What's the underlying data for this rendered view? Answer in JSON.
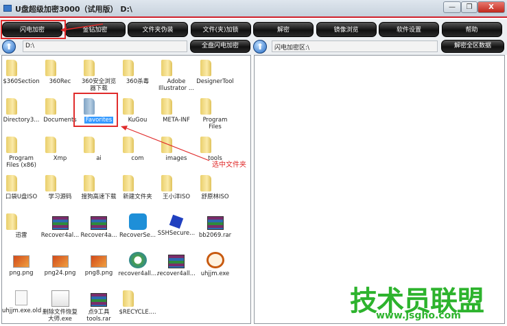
{
  "window": {
    "title": "U盘超级加密3000（试用版） D:\\",
    "minimize": "—",
    "restore": "❐",
    "close": "X"
  },
  "toolbar": {
    "buttons": [
      "闪电加密",
      "金钻加密",
      "文件夹伪装",
      "文件(夹)加锁",
      "解密",
      "镜像浏览",
      "软件设置",
      "帮助"
    ]
  },
  "left": {
    "path": "D:\\",
    "action": "全盘闪电加密"
  },
  "right": {
    "path": "闪电加密区:\\",
    "action": "解密全区数据"
  },
  "files": [
    {
      "name": "$360Section",
      "type": "folder"
    },
    {
      "name": "360Rec",
      "type": "folder"
    },
    {
      "name": "360安全浏览器下载",
      "type": "folder"
    },
    {
      "name": "360杀毒",
      "type": "folder"
    },
    {
      "name": "Adobe Illustrator ...",
      "type": "folder"
    },
    {
      "name": "DesignerTool",
      "type": "folder"
    },
    {
      "name": "Directory3...",
      "type": "folder"
    },
    {
      "name": "Documents",
      "type": "folder"
    },
    {
      "name": "Favorites",
      "type": "folder",
      "selected": true
    },
    {
      "name": "KuGou",
      "type": "folder"
    },
    {
      "name": "META-INF",
      "type": "folder"
    },
    {
      "name": "Program Files",
      "type": "folder"
    },
    {
      "name": "Program Files (x86)",
      "type": "folder"
    },
    {
      "name": "Xmp",
      "type": "folder"
    },
    {
      "name": "ai",
      "type": "folder"
    },
    {
      "name": "com",
      "type": "folder"
    },
    {
      "name": "images",
      "type": "folder"
    },
    {
      "name": "tools",
      "type": "folder"
    },
    {
      "name": "口袋U盘ISO",
      "type": "folder"
    },
    {
      "name": "学习源码",
      "type": "folder"
    },
    {
      "name": "搜狗高速下载",
      "type": "folder"
    },
    {
      "name": "新建文件夹",
      "type": "folder"
    },
    {
      "name": "王小洋ISO",
      "type": "folder"
    },
    {
      "name": "舒原林ISO",
      "type": "folder"
    },
    {
      "name": "迅雷",
      "type": "folder"
    },
    {
      "name": "Recover4al...",
      "type": "rar"
    },
    {
      "name": "Recover4a...",
      "type": "rar"
    },
    {
      "name": "RecoverSe...",
      "type": "exe-blue"
    },
    {
      "name": "SSHSecure...",
      "type": "cube"
    },
    {
      "name": "bb2069.rar",
      "type": "rar"
    },
    {
      "name": "png.png",
      "type": "png"
    },
    {
      "name": "png24.png",
      "type": "png"
    },
    {
      "name": "png8.png",
      "type": "png"
    },
    {
      "name": "recover4all....",
      "type": "circ"
    },
    {
      "name": "recover4all...",
      "type": "rar"
    },
    {
      "name": "uhjjm.exe",
      "type": "lock"
    },
    {
      "name": "uhjjm.exe.old",
      "type": "doc"
    },
    {
      "name": "删除文件恢复大师.exe",
      "type": "chart"
    },
    {
      "name": "点9工具 tools.rar",
      "type": "rar"
    },
    {
      "name": "$RECYCLE....",
      "type": "folder"
    }
  ],
  "annotation": "选中文件夹",
  "watermark": {
    "text": "技术员联盟",
    "url": "www.jsgho.com",
    "color": "#2db32d"
  },
  "colors": {
    "accent": "#e02a2a",
    "button": "#1a1a1a",
    "selection": "#3399ff"
  }
}
